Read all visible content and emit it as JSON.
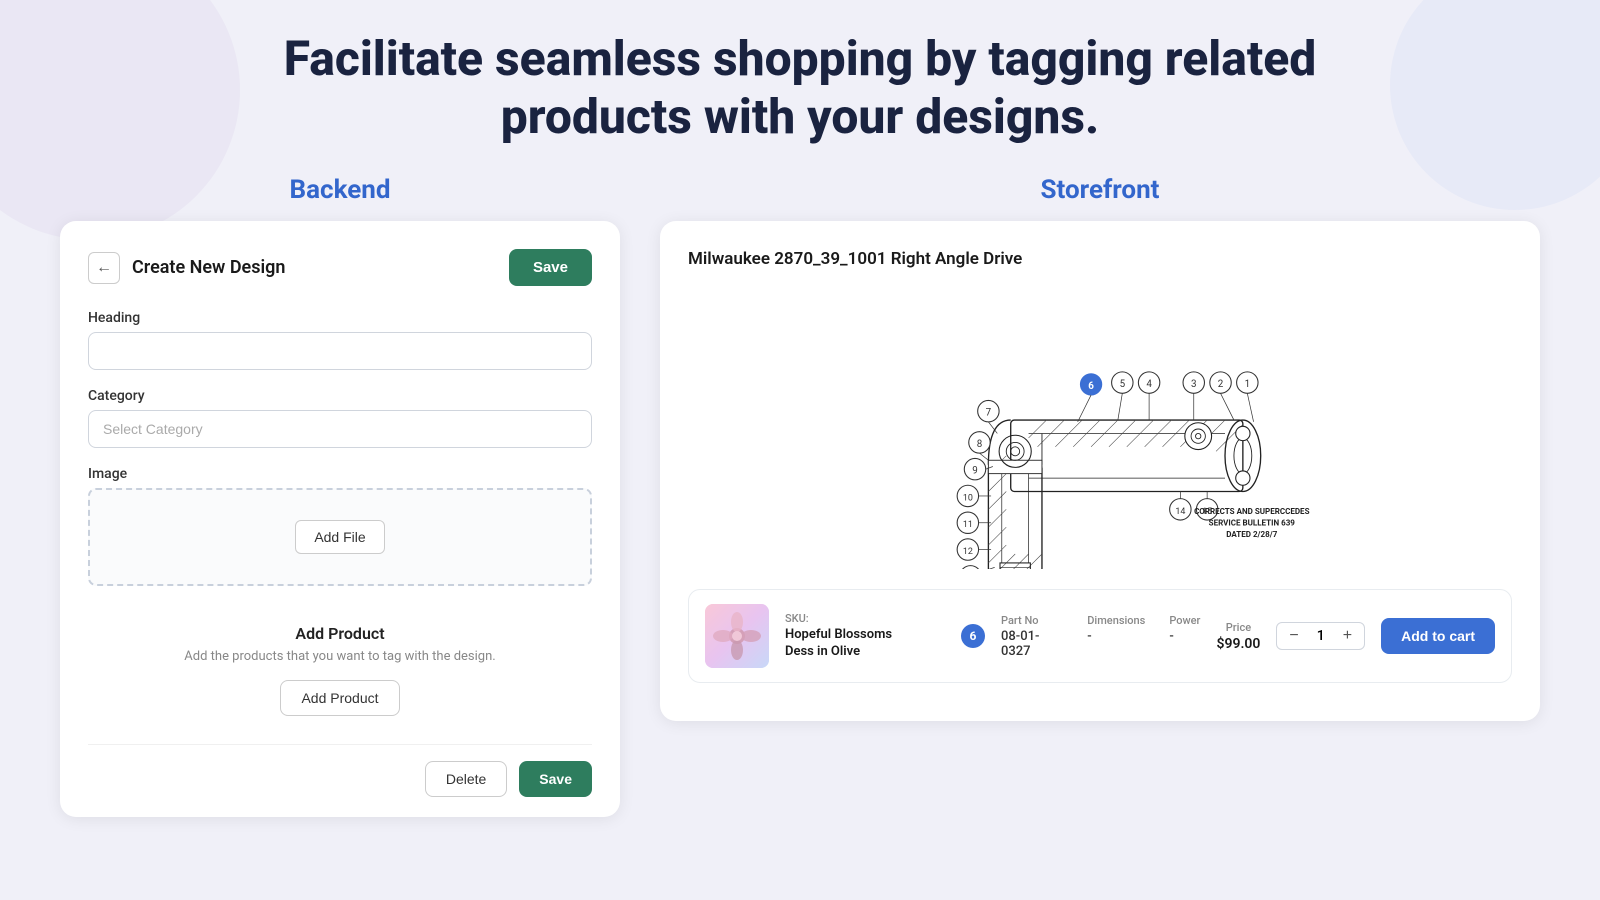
{
  "page": {
    "hero_title_line1": "Facilitate seamless shopping by tagging related",
    "hero_title_line2": "products with your designs."
  },
  "backend": {
    "section_label": "Backend",
    "panel": {
      "title": "Create New Design",
      "save_top_label": "Save",
      "heading_label": "Heading",
      "heading_placeholder": "",
      "category_label": "Category",
      "category_placeholder": "Select Category",
      "image_label": "Image",
      "add_file_label": "Add File",
      "add_product_title": "Add Product",
      "add_product_desc": "Add the products that you want to tag with the design.",
      "add_product_btn_label": "Add Product",
      "delete_label": "Delete",
      "save_bottom_label": "Save"
    }
  },
  "storefront": {
    "section_label": "Storefront",
    "product_title": "Milwaukee 2870_39_1001 Right Angle Drive",
    "diagram": {
      "bulletin_line1": "CORRECTS AND SUPERCCEDES",
      "bulletin_line2": "SERVICE BULLETIN 639",
      "bulletin_line3": "DATED 2/28/7"
    },
    "product_card": {
      "sku_label": "SKU:",
      "sku_value": "",
      "product_name_line1": "Hopeful Blossoms",
      "product_name_line2": "Dess in Olive",
      "tag_number": "6",
      "part_no_label": "Part No",
      "part_no_value": "08-01-0327",
      "dimensions_label": "Dimensions",
      "dimensions_value": "-",
      "power_label": "Power",
      "power_value": "-",
      "price_label": "Price",
      "price_value": "$99.00",
      "qty_value": "1",
      "qty_minus": "−",
      "qty_plus": "+",
      "add_to_cart_label": "Add to cart"
    }
  }
}
